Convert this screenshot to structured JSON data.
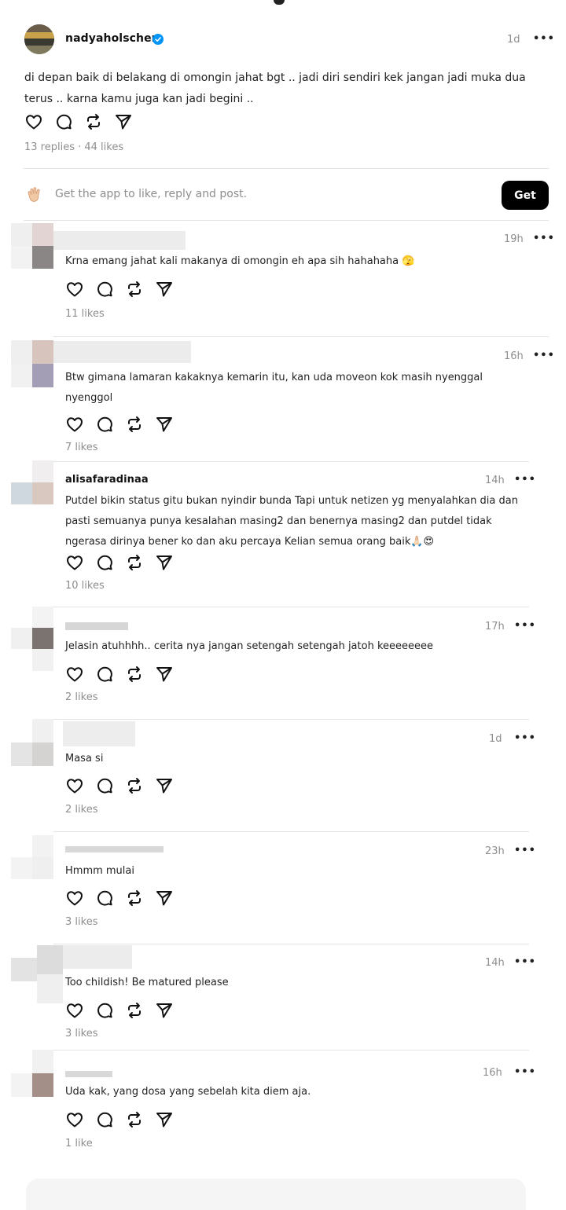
{
  "post": {
    "username": "nadyaholscher",
    "time": "1d",
    "more": "•••",
    "text": "di depan baik di belakang di omongin jahat bgt .. jadi diri sendiri kek jangan jadi muka dua terus .. karna kamu juga kan jadi begini ..",
    "stats": "13 replies · 44 likes"
  },
  "get_app": {
    "text": "Get the app to like, reply and post.",
    "button": "Get"
  },
  "icons": {
    "like": "heart-icon",
    "reply": "comment-icon",
    "repost": "repost-icon",
    "share": "send-icon",
    "verified": "verified-badge-icon"
  },
  "colors": {
    "verified": "#0095f6",
    "button_bg": "#000000",
    "muted": "#8e8e8e"
  },
  "replies": [
    {
      "username": "",
      "time": "19h",
      "text": "Krna emang jahat kali makanya di omongin eh apa sih hahahaha 🫣",
      "likes": "11 likes"
    },
    {
      "username": "",
      "time": "16h",
      "text": "Btw gimana lamaran kakaknya kemarin itu, kan uda moveon kok masih nyenggal nyenggol",
      "likes": "7 likes"
    },
    {
      "username": "alisafaradinaa",
      "time": "14h",
      "text": "Putdel bikin status gitu bukan nyindir bunda Tapi untuk netizen yg menyalahkan dia dan pasti semuanya punya kesalahan masing2 dan benernya  masing2 dan putdel tidak ngerasa dirinya bener ko dan aku percaya Kelian semua orang baik🙏🏻😍",
      "likes": "10 likes"
    },
    {
      "username": "",
      "time": "17h",
      "text": "Jelasin atuhhhh.. cerita nya jangan setengah setengah jatoh keeeeeeee",
      "likes": "2 likes"
    },
    {
      "username": "",
      "time": "1d",
      "text": "Masa si",
      "likes": "2 likes"
    },
    {
      "username": "",
      "time": "23h",
      "text": "Hmmm mulai",
      "likes": "3 likes"
    },
    {
      "username": "",
      "time": "14h",
      "text": "Too childish! Be matured please",
      "likes": "3 likes"
    },
    {
      "username": "",
      "time": "16h",
      "text": "Uda kak, yang dosa yang sebelah kita diem aja.",
      "likes": "1 like"
    }
  ]
}
